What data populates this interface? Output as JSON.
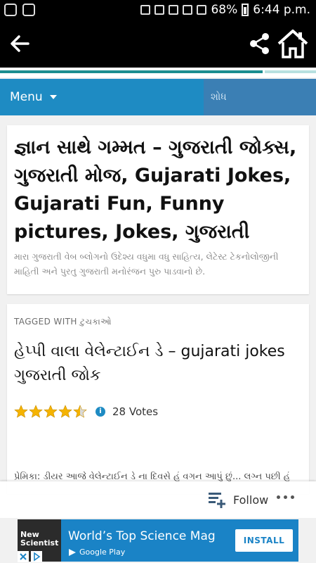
{
  "status_bar": {
    "battery": "68%",
    "time": "6:44 p.m."
  },
  "app_bar": {
    "back_icon": "arrow-left-icon",
    "share_icon": "share-icon",
    "home_icon": "home-icon"
  },
  "page_progress": 0.83,
  "nav": {
    "menu_label": "Menu",
    "search_placeholder": "શોધ"
  },
  "site": {
    "title": "જ્ઞાન સાથે ગમ્મત – ગુજરાતી જોક્સ, ગુજરાતી મોજ, Gujarati Jokes, Gujarati Fun, Funny pictures, Jokes, ગુજરાતી",
    "description": "મારા ગુજરાતી વેબ બ્લોગનો ઉદેશ્ય વધુમા વધુ સાહિત્ય, લેટેસ્ટ ટેકનોલોજીની માહિતી અને પુરતુ ગુજરાતી મનોરંજન પુરુ પાડવાનો છે."
  },
  "post": {
    "tagged_prefix": "TAGGED WITH",
    "tag": "ટુચકાઓ",
    "title": "હેપ્પી વાલા વેલેન્ટાઈન ડે – gujarati jokes ગુજરાતી જોક",
    "rating": 4.5,
    "rating_max": 5,
    "votes_label": "28 Votes",
    "excerpt": "પ્રેમિકા: ડીયર આજે વેલેન્ટાઈન ડે ના દિવસે હું વગન આપું છું... લગ્ન પછી હું"
  },
  "follow_bar": {
    "follow_label": "Follow"
  },
  "ad": {
    "logo_text": "New Scientist",
    "title": "World’s Top Science Mag",
    "store_label": "Google Play",
    "install_label": "INSTALL"
  },
  "colors": {
    "accent_blue": "#1e8bc3",
    "star_gold": "#f5b301",
    "progress_teal": "#1a8d8f"
  }
}
